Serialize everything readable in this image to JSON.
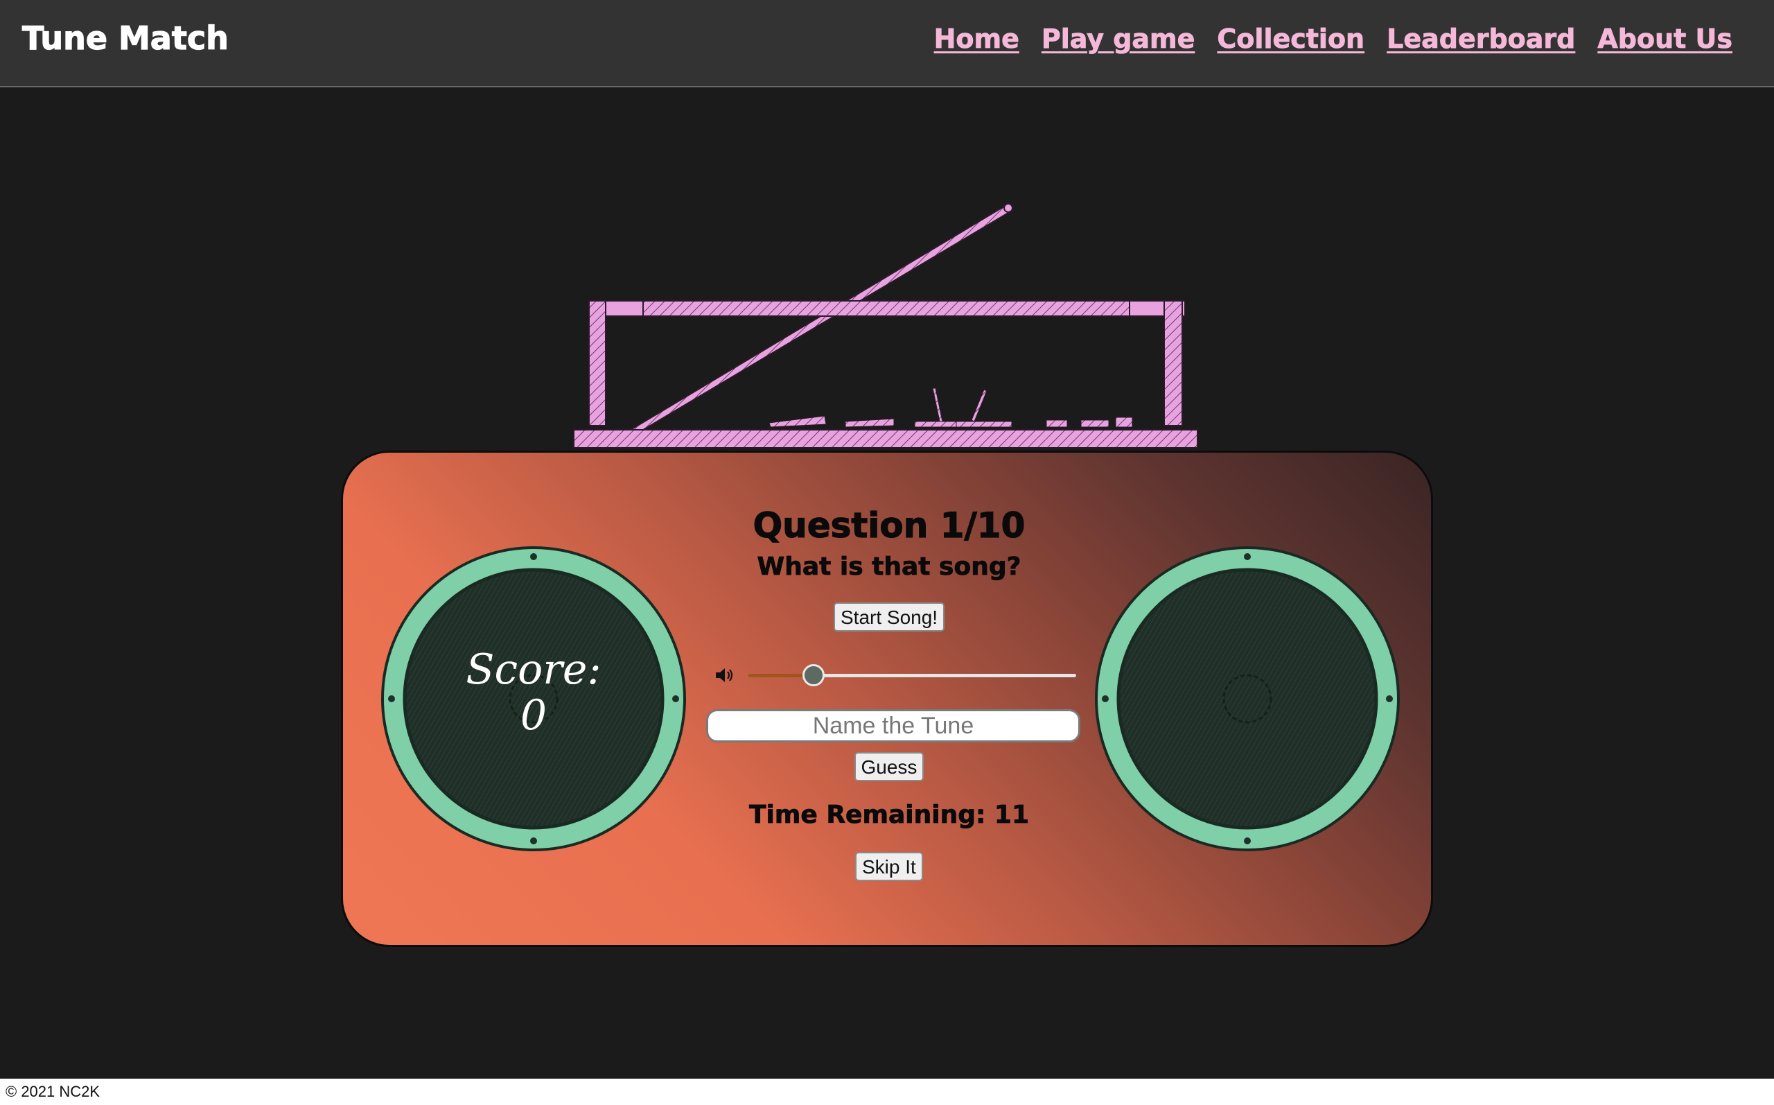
{
  "header": {
    "brand": "Tune Match",
    "nav": [
      {
        "label": "Home"
      },
      {
        "label": "Play game"
      },
      {
        "label": "Collection"
      },
      {
        "label": "Leaderboard"
      },
      {
        "label": "About Us"
      }
    ]
  },
  "game": {
    "question_title": "Question 1/10",
    "question_prompt": "What is that song?",
    "start_button": "Start Song!",
    "volume": {
      "icon": "volume-icon",
      "level_fraction": 0.2
    },
    "guess_input": {
      "value": "",
      "placeholder": "Name the Tune"
    },
    "guess_button": "Guess",
    "time_remaining": "Time Remaining: 11",
    "skip_button": "Skip It",
    "score_label": "Score:",
    "score_value": "0"
  },
  "colors": {
    "nav_link": "#f5b8d8",
    "speaker_ring": "#7fcfa8",
    "speaker_cone": "#203028",
    "lid": "#e7a2df"
  },
  "footer": {
    "copyright": "© 2021 NC2K"
  }
}
